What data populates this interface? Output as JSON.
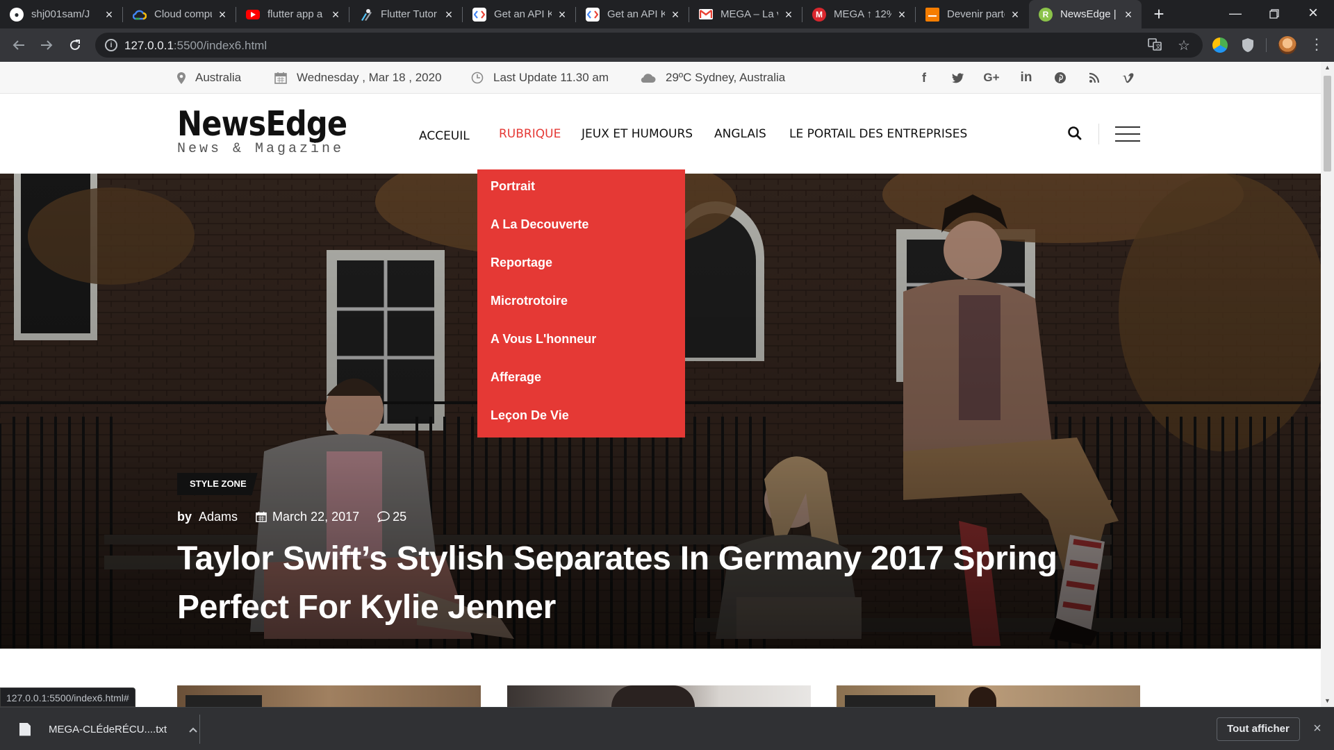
{
  "browser": {
    "tabs": [
      {
        "title": "shj001sam/J",
        "favicon": "github-icon",
        "color": "#24292e"
      },
      {
        "title": "Cloud compu",
        "favicon": "google-cloud-icon",
        "color": "#4285f4"
      },
      {
        "title": "flutter app a",
        "favicon": "youtube-icon",
        "color": "#ff0000"
      },
      {
        "title": "Flutter Tutor",
        "favicon": "flutter-icon",
        "color": "#54c5f8"
      },
      {
        "title": "Get an API K",
        "favicon": "developers-icon",
        "color": "#ffffff"
      },
      {
        "title": "Get an API K",
        "favicon": "developers-icon",
        "color": "#ffffff"
      },
      {
        "title": "MEGA – La v",
        "favicon": "gmail-icon",
        "color": "#ffffff"
      },
      {
        "title": "MEGA ↑ 12%",
        "favicon": "mega-icon",
        "color": "#d9272e"
      },
      {
        "title": "Devenir parte",
        "favicon": "blogger-icon",
        "color": "#f57d00"
      },
      {
        "title": "NewsEdge |",
        "favicon": "newsedge-icon",
        "color": "#8bc34a"
      }
    ],
    "url_host": "127.0.0.1",
    "url_rest": ":5500/index6.html",
    "status_url": "127.0.0.1:5500/index6.html#",
    "download": {
      "filename": "MEGA-CLÉdeRÉCU....txt",
      "show_all": "Tout afficher"
    }
  },
  "site": {
    "topbar": {
      "location": "Australia",
      "date": "Wednesday , Mar 18 , 2020",
      "update": "Last Update 11.30 am",
      "weather": "29ºC Sydney, Australia"
    },
    "social": [
      "f",
      "t",
      "G+",
      "in",
      "P",
      "rss",
      "v"
    ],
    "logo": {
      "name": "NewsEdge",
      "tagline": "News & Magazine"
    },
    "menu": [
      "ACCEUIL",
      "RUBRIQUE",
      "JEUX ET HUMOURS",
      "ANGLAIS",
      "LE PORTAIL DES ENTREPRISES"
    ],
    "dropdown": [
      "Portrait",
      "A La Decouverte",
      "Reportage",
      "Microtrotoire",
      "A Vous L'honneur",
      "Afferage",
      "Leçon De Vie"
    ],
    "hero": {
      "badge": "STYLE ZONE",
      "by": "by",
      "author": "Adams",
      "date": "March 22, 2017",
      "comments": "25",
      "title": "Taylor Swift’s Stylish Separates In Germany 2017 Spring Perfect For Kylie Jenner"
    },
    "accent": "#e53935"
  }
}
